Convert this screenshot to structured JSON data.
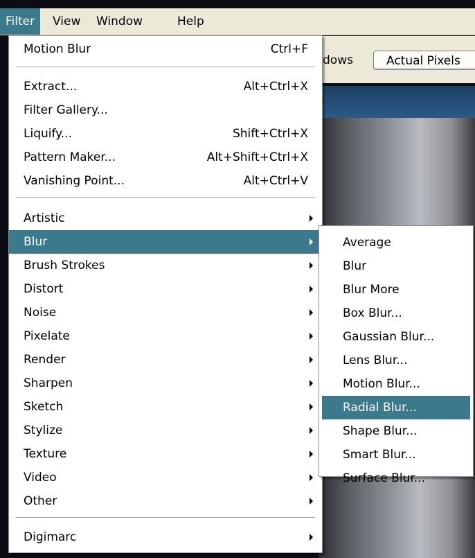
{
  "menubar": {
    "items": [
      {
        "label": "Filter",
        "active": true
      },
      {
        "label": "View"
      },
      {
        "label": "Window"
      },
      {
        "label": "Help"
      }
    ]
  },
  "options_bar": {
    "windows_fragment": "dows",
    "actual_pixels_label": "Actual Pixels"
  },
  "filter_menu": {
    "last_filter": {
      "label": "Motion Blur",
      "shortcut": "Ctrl+F"
    },
    "special_filters": [
      {
        "label": "Extract...",
        "shortcut": "Alt+Ctrl+X"
      },
      {
        "label": "Filter Gallery...",
        "shortcut": ""
      },
      {
        "label": "Liquify...",
        "shortcut": "Shift+Ctrl+X"
      },
      {
        "label": "Pattern Maker...",
        "shortcut": "Alt+Shift+Ctrl+X"
      },
      {
        "label": "Vanishing Point...",
        "shortcut": "Alt+Ctrl+V"
      }
    ],
    "categories": [
      {
        "label": "Artistic"
      },
      {
        "label": "Blur",
        "highlighted": true
      },
      {
        "label": "Brush Strokes"
      },
      {
        "label": "Distort"
      },
      {
        "label": "Noise"
      },
      {
        "label": "Pixelate"
      },
      {
        "label": "Render"
      },
      {
        "label": "Sharpen"
      },
      {
        "label": "Sketch"
      },
      {
        "label": "Stylize"
      },
      {
        "label": "Texture"
      },
      {
        "label": "Video"
      },
      {
        "label": "Other"
      }
    ],
    "plugins": [
      {
        "label": "Digimarc"
      }
    ]
  },
  "blur_submenu": {
    "items": [
      {
        "label": "Average"
      },
      {
        "label": "Blur"
      },
      {
        "label": "Blur More"
      },
      {
        "label": "Box Blur..."
      },
      {
        "label": "Gaussian Blur..."
      },
      {
        "label": "Lens Blur..."
      },
      {
        "label": "Motion Blur..."
      },
      {
        "label": "Radial Blur...",
        "highlighted": true
      },
      {
        "label": "Shape Blur..."
      },
      {
        "label": "Smart Blur..."
      },
      {
        "label": "Surface Blur..."
      }
    ]
  },
  "colors": {
    "highlight": "#3b7a8c",
    "menubar_bg": "#ece9d8",
    "menu_bg": "#ffffff"
  }
}
